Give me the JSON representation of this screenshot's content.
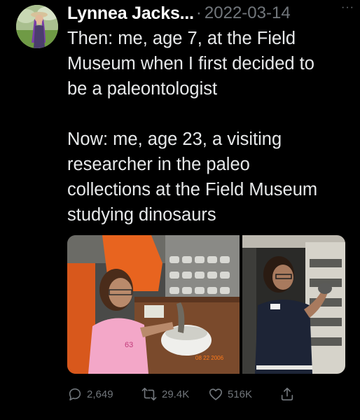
{
  "tweet": {
    "author_name": "Lynnea Jacks...",
    "separator": "·",
    "date": "2022-03-14",
    "more_icon": "···",
    "text_then": "Then: me, age 7, at the Field\nMuseum when I first decided to\nbe a paleontologist",
    "text_now": "Now: me, age 23, a visiting\nresearcher in the paleo\ncollections at the Field Museum\nstudying dinosaurs",
    "photo_left_timestamp": "08 22 2006",
    "shirt_number": "63"
  },
  "actions": {
    "replies": "2,649",
    "retweets": "29.4K",
    "likes": "516K",
    "reply_icon": "reply-icon",
    "retweet_icon": "retweet-icon",
    "like_icon": "heart-icon",
    "share_icon": "share-icon"
  },
  "colors": {
    "background": "#000000",
    "text_primary": "#e7e9ea",
    "text_secondary": "#71767b"
  }
}
